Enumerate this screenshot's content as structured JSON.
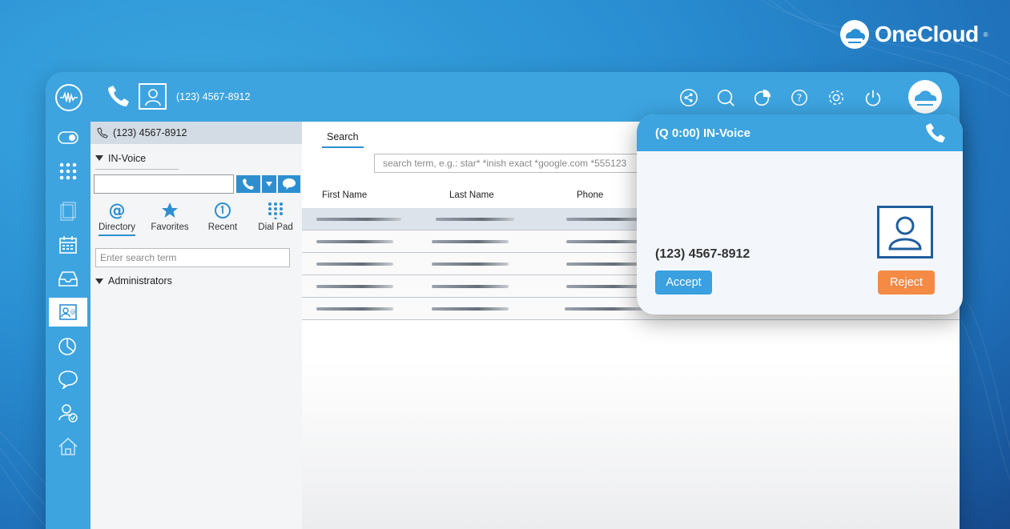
{
  "brand": {
    "name": "OneCloud",
    "trademark": "®"
  },
  "topbar": {
    "phone_number": "(123) 4567-8912",
    "icons": [
      "share-icon",
      "search-icon",
      "pie-chart-icon",
      "help-icon",
      "gear-icon",
      "power-icon",
      "onecloud-logo-icon"
    ]
  },
  "leftnav": {
    "items": [
      "toggle-icon",
      "grid-icon",
      "document-icon",
      "calendar-icon",
      "inbox-icon",
      "contacts-icon",
      "chart-icon",
      "chat-icon",
      "user-check-icon",
      "home-icon"
    ],
    "active": "contacts-icon"
  },
  "panel": {
    "phone_number": "(123) 4567-8912",
    "queue": "IN-Voice",
    "tabs": [
      {
        "label": "Directory",
        "icon": "at-icon"
      },
      {
        "label": "Favorites",
        "icon": "star-icon"
      },
      {
        "label": "Recent",
        "icon": "recent-icon"
      },
      {
        "label": "Dial Pad",
        "icon": "dialpad-icon"
      }
    ],
    "search_placeholder": "Enter search term",
    "group": "Administrators"
  },
  "main": {
    "tab": "Search",
    "search_placeholder": "search term, e.g.: star* *inish exact *google.com *555123",
    "columns": [
      "First Name",
      "Last Name",
      "Phone"
    ]
  },
  "popup": {
    "title": "(Q 0:00) IN-Voice",
    "caller_number": "(123) 4567-8912",
    "accept_label": "Accept",
    "reject_label": "Reject"
  },
  "colors": {
    "accent": "#3da4e0",
    "reject": "#f58a45",
    "accept": "#3aa0df"
  }
}
